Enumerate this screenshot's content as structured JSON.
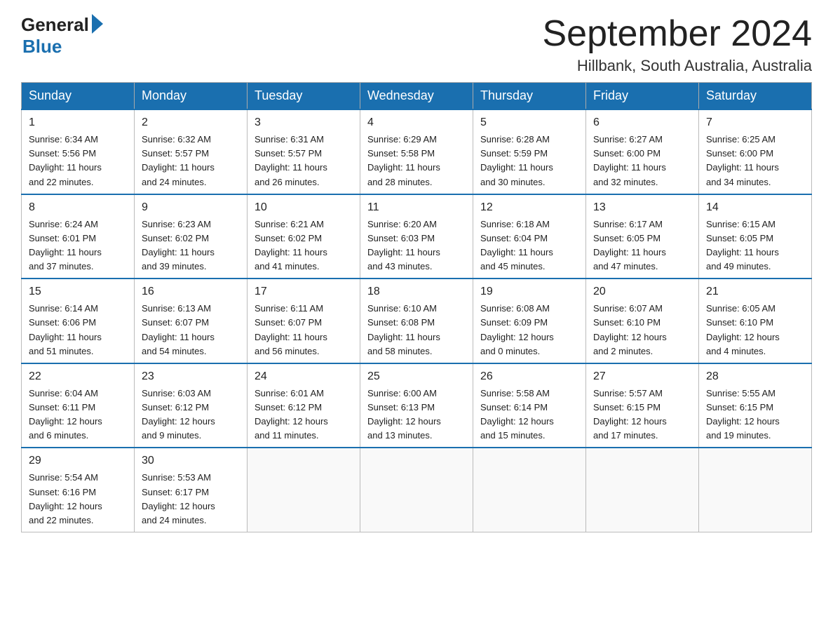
{
  "header": {
    "logo_general": "General",
    "logo_blue": "Blue",
    "month_title": "September 2024",
    "location": "Hillbank, South Australia, Australia"
  },
  "days_of_week": [
    "Sunday",
    "Monday",
    "Tuesday",
    "Wednesday",
    "Thursday",
    "Friday",
    "Saturday"
  ],
  "weeks": [
    [
      {
        "day": "1",
        "sunrise": "6:34 AM",
        "sunset": "5:56 PM",
        "daylight": "11 hours and 22 minutes."
      },
      {
        "day": "2",
        "sunrise": "6:32 AM",
        "sunset": "5:57 PM",
        "daylight": "11 hours and 24 minutes."
      },
      {
        "day": "3",
        "sunrise": "6:31 AM",
        "sunset": "5:57 PM",
        "daylight": "11 hours and 26 minutes."
      },
      {
        "day": "4",
        "sunrise": "6:29 AM",
        "sunset": "5:58 PM",
        "daylight": "11 hours and 28 minutes."
      },
      {
        "day": "5",
        "sunrise": "6:28 AM",
        "sunset": "5:59 PM",
        "daylight": "11 hours and 30 minutes."
      },
      {
        "day": "6",
        "sunrise": "6:27 AM",
        "sunset": "6:00 PM",
        "daylight": "11 hours and 32 minutes."
      },
      {
        "day": "7",
        "sunrise": "6:25 AM",
        "sunset": "6:00 PM",
        "daylight": "11 hours and 34 minutes."
      }
    ],
    [
      {
        "day": "8",
        "sunrise": "6:24 AM",
        "sunset": "6:01 PM",
        "daylight": "11 hours and 37 minutes."
      },
      {
        "day": "9",
        "sunrise": "6:23 AM",
        "sunset": "6:02 PM",
        "daylight": "11 hours and 39 minutes."
      },
      {
        "day": "10",
        "sunrise": "6:21 AM",
        "sunset": "6:02 PM",
        "daylight": "11 hours and 41 minutes."
      },
      {
        "day": "11",
        "sunrise": "6:20 AM",
        "sunset": "6:03 PM",
        "daylight": "11 hours and 43 minutes."
      },
      {
        "day": "12",
        "sunrise": "6:18 AM",
        "sunset": "6:04 PM",
        "daylight": "11 hours and 45 minutes."
      },
      {
        "day": "13",
        "sunrise": "6:17 AM",
        "sunset": "6:05 PM",
        "daylight": "11 hours and 47 minutes."
      },
      {
        "day": "14",
        "sunrise": "6:15 AM",
        "sunset": "6:05 PM",
        "daylight": "11 hours and 49 minutes."
      }
    ],
    [
      {
        "day": "15",
        "sunrise": "6:14 AM",
        "sunset": "6:06 PM",
        "daylight": "11 hours and 51 minutes."
      },
      {
        "day": "16",
        "sunrise": "6:13 AM",
        "sunset": "6:07 PM",
        "daylight": "11 hours and 54 minutes."
      },
      {
        "day": "17",
        "sunrise": "6:11 AM",
        "sunset": "6:07 PM",
        "daylight": "11 hours and 56 minutes."
      },
      {
        "day": "18",
        "sunrise": "6:10 AM",
        "sunset": "6:08 PM",
        "daylight": "11 hours and 58 minutes."
      },
      {
        "day": "19",
        "sunrise": "6:08 AM",
        "sunset": "6:09 PM",
        "daylight": "12 hours and 0 minutes."
      },
      {
        "day": "20",
        "sunrise": "6:07 AM",
        "sunset": "6:10 PM",
        "daylight": "12 hours and 2 minutes."
      },
      {
        "day": "21",
        "sunrise": "6:05 AM",
        "sunset": "6:10 PM",
        "daylight": "12 hours and 4 minutes."
      }
    ],
    [
      {
        "day": "22",
        "sunrise": "6:04 AM",
        "sunset": "6:11 PM",
        "daylight": "12 hours and 6 minutes."
      },
      {
        "day": "23",
        "sunrise": "6:03 AM",
        "sunset": "6:12 PM",
        "daylight": "12 hours and 9 minutes."
      },
      {
        "day": "24",
        "sunrise": "6:01 AM",
        "sunset": "6:12 PM",
        "daylight": "12 hours and 11 minutes."
      },
      {
        "day": "25",
        "sunrise": "6:00 AM",
        "sunset": "6:13 PM",
        "daylight": "12 hours and 13 minutes."
      },
      {
        "day": "26",
        "sunrise": "5:58 AM",
        "sunset": "6:14 PM",
        "daylight": "12 hours and 15 minutes."
      },
      {
        "day": "27",
        "sunrise": "5:57 AM",
        "sunset": "6:15 PM",
        "daylight": "12 hours and 17 minutes."
      },
      {
        "day": "28",
        "sunrise": "5:55 AM",
        "sunset": "6:15 PM",
        "daylight": "12 hours and 19 minutes."
      }
    ],
    [
      {
        "day": "29",
        "sunrise": "5:54 AM",
        "sunset": "6:16 PM",
        "daylight": "12 hours and 22 minutes."
      },
      {
        "day": "30",
        "sunrise": "5:53 AM",
        "sunset": "6:17 PM",
        "daylight": "12 hours and 24 minutes."
      },
      null,
      null,
      null,
      null,
      null
    ]
  ]
}
